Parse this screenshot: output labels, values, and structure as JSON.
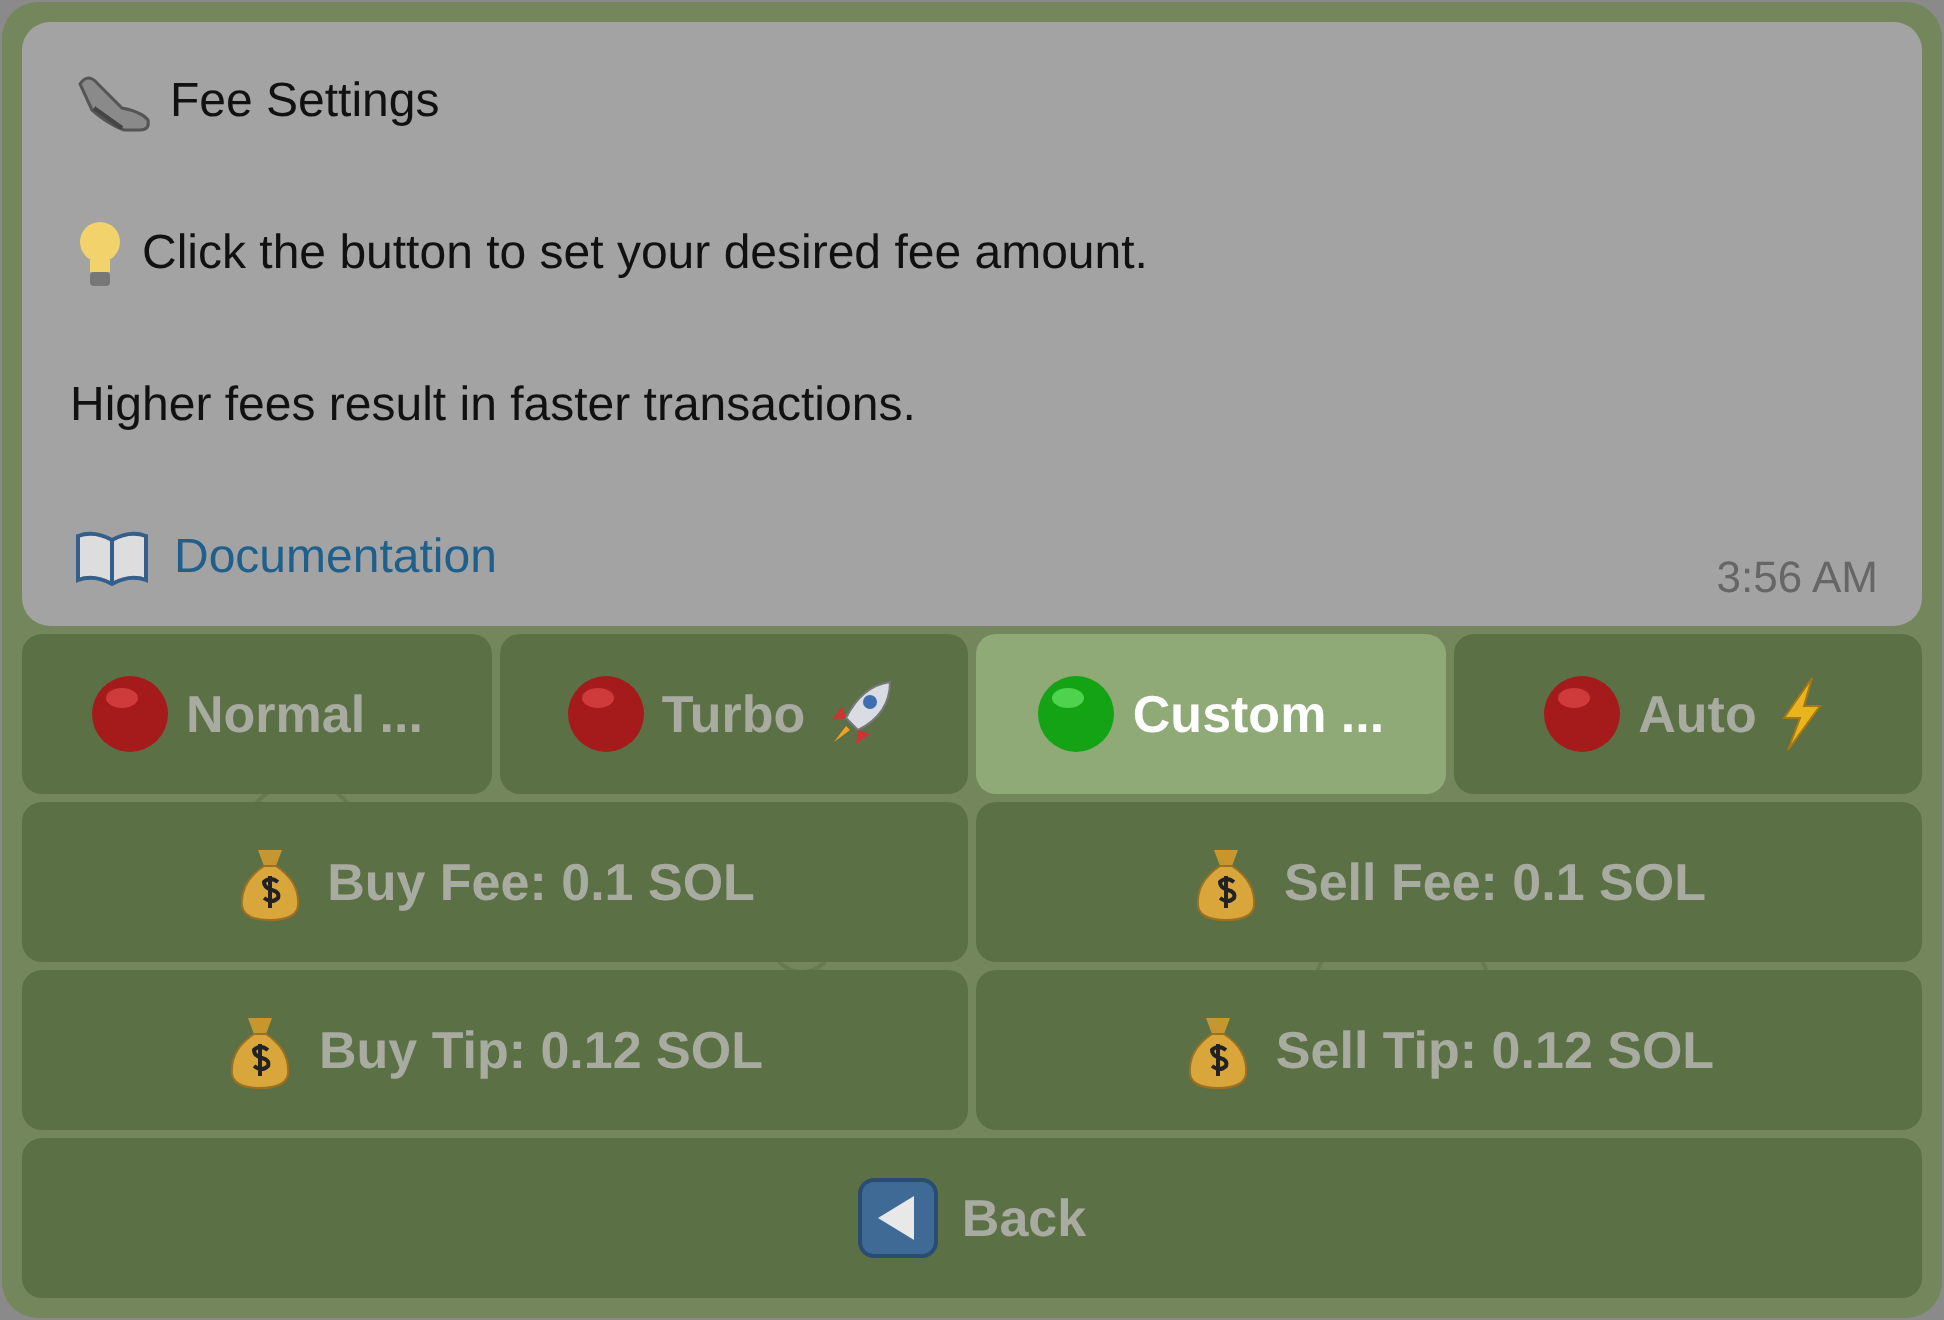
{
  "message": {
    "title": "Fee Settings",
    "hint": "Click the button to set your desired fee amount.",
    "note": "Higher fees result in faster transactions.",
    "link": "Documentation",
    "time": "3:56 AM"
  },
  "fee_modes": [
    {
      "label": "Normal ...",
      "selected": false
    },
    {
      "label": "Turbo",
      "selected": false
    },
    {
      "label": "Custom ...",
      "selected": true
    },
    {
      "label": "Auto",
      "selected": false
    }
  ],
  "amount_buttons": [
    {
      "label": "Buy Fee: 0.1 SOL"
    },
    {
      "label": "Sell Fee: 0.1 SOL"
    },
    {
      "label": "Buy Tip: 0.12 SOL"
    },
    {
      "label": "Sell Tip: 0.12 SOL"
    }
  ],
  "back_button": {
    "label": "Back"
  }
}
